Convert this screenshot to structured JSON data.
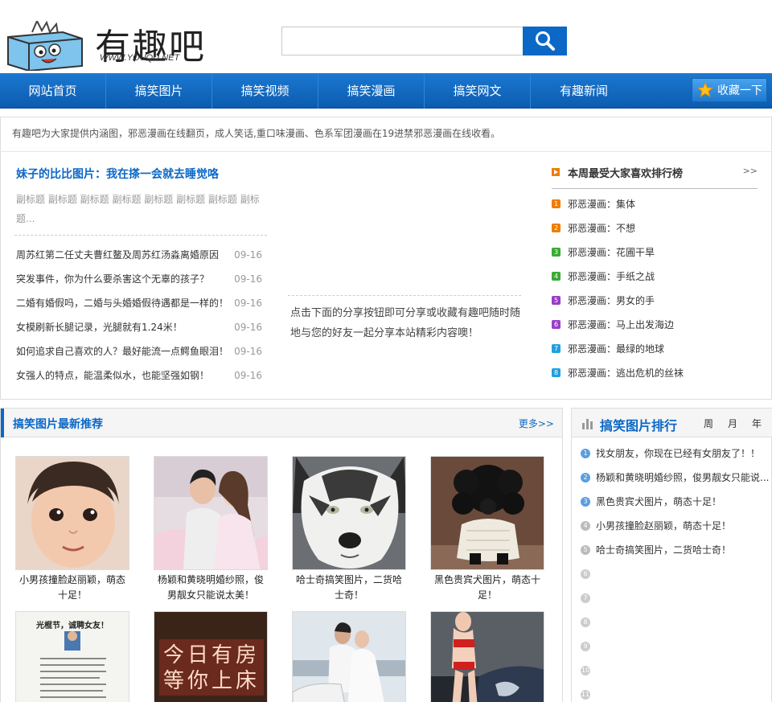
{
  "header": {
    "logo_title": "有趣吧",
    "logo_url": "WWW.YOUQU.NET",
    "search_placeholder": "",
    "search_value": ""
  },
  "nav": {
    "items": [
      "网站首页",
      "搞笑图片",
      "搞笑视频",
      "搞笑漫画",
      "搞笑网文",
      "有趣新闻"
    ],
    "fav_label": "收藏一下"
  },
  "intro_text": "有趣吧为大家提供内涵图，邪恶漫画在线翻页，成人笑话,重口味漫画、色系军团漫画在19进禁邪恶漫画在线收看。",
  "headline": {
    "title": "妹子的比比图片：我在搽一会就去睡觉咯",
    "subtitle": "副标题 副标题 副标题 副标题 副标题 副标题 副标题 副标题..."
  },
  "news": [
    {
      "title": "周苏红第二任丈夫曹红鳌及周苏红汤淼离婚原因",
      "date": "09-16"
    },
    {
      "title": "突发事件，你为什么要杀害这个无辜的孩子？",
      "date": "09-16"
    },
    {
      "title": "二婚有婚假吗，二婚与头婚婚假待遇都是一样的！",
      "date": "09-16"
    },
    {
      "title": "女模刷新长腿记录，光腿就有1.24米！",
      "date": "09-16"
    },
    {
      "title": "如何追求自己喜欢的人？最好能流一点鳄鱼眼泪！",
      "date": "09-16"
    },
    {
      "title": "女强人的特点，能温柔似水，也能坚强如钢！",
      "date": "09-16"
    }
  ],
  "share_text": "点击下面的分享按钮即可分享或收藏有趣吧随时随地与您的好友一起分享本站精彩内容噢！",
  "weekly_rank": {
    "title": "本周最受大家喜欢排行榜",
    "more": ">>",
    "items": [
      {
        "num": "1",
        "label": "邪恶漫画：集体",
        "color": "#f07c00"
      },
      {
        "num": "2",
        "label": "邪恶漫画：不想",
        "color": "#f07c00"
      },
      {
        "num": "3",
        "label": "邪恶漫画：花圃干旱",
        "color": "#3aaa35"
      },
      {
        "num": "4",
        "label": "邪恶漫画：手纸之战",
        "color": "#3aaa35"
      },
      {
        "num": "5",
        "label": "邪恶漫画：男女的手",
        "color": "#9b3dc9"
      },
      {
        "num": "6",
        "label": "邪恶漫画：马上出发海边",
        "color": "#9b3dc9"
      },
      {
        "num": "7",
        "label": "邪恶漫画：最绿的地球",
        "color": "#1fa0e0"
      },
      {
        "num": "8",
        "label": "邪恶漫画：逃出危机的丝袜",
        "color": "#1fa0e0"
      }
    ]
  },
  "pictures": {
    "title": "搞笑图片最新推荐",
    "more": "更多>>",
    "accent": "#0c68c6",
    "items": [
      {
        "caption": "小男孩撞脸赵丽颖，萌态十足！"
      },
      {
        "caption": "杨颖和黄晓明婚纱照，俊男靓女只能说太美！"
      },
      {
        "caption": "哈士奇搞笑图片，二货哈士奇！"
      },
      {
        "caption": "黑色贵宾犬图片，萌态十足！"
      },
      {
        "caption": "",
        "sign_title": "光棍节，诚聘女友！"
      },
      {
        "caption": "",
        "sign_text": "今日有房等你上床"
      },
      {
        "caption": ""
      },
      {
        "caption": ""
      }
    ]
  },
  "pic_rank": {
    "title": "搞笑图片排行",
    "tabs": [
      "周",
      "月",
      "年"
    ],
    "items": [
      {
        "num": "1",
        "label": "找女朋友，你现在已经有女朋友了！！"
      },
      {
        "num": "2",
        "label": "杨颖和黄晓明婚纱照，俊男靓女只能说..."
      },
      {
        "num": "3",
        "label": "黑色贵宾犬图片，萌态十足！"
      },
      {
        "num": "4",
        "label": "小男孩撞脸赵丽颖，萌态十足！"
      },
      {
        "num": "5",
        "label": "哈士奇搞笑图片，二货哈士奇！"
      },
      {
        "num": "6",
        "label": ""
      },
      {
        "num": "7",
        "label": ""
      },
      {
        "num": "8",
        "label": ""
      },
      {
        "num": "9",
        "label": ""
      },
      {
        "num": "10",
        "label": ""
      },
      {
        "num": "11",
        "label": ""
      }
    ]
  }
}
